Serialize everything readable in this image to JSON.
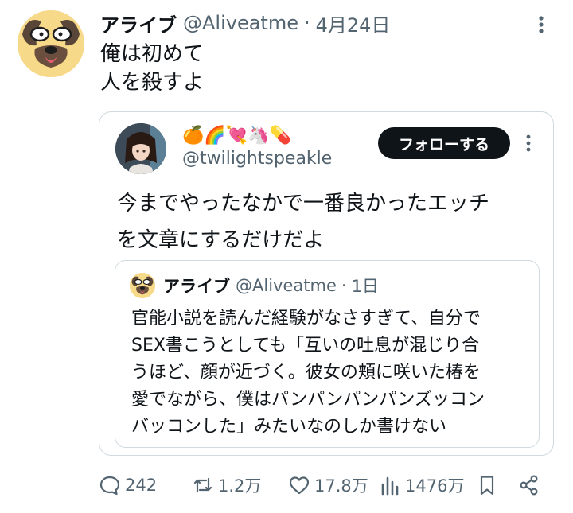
{
  "tweet": {
    "author_name": "アライブ",
    "author_handle": "@Aliveatme",
    "separator": "·",
    "date": "4月24日",
    "text": "俺は初めて\n人を殺すよ"
  },
  "quoted_tweet": {
    "emojis": "🍊🌈💘🦄💊",
    "handle": "@twilightspeakle",
    "follow_label": "フォローする",
    "text": "今までやったなかで一番良かったエッチ\nを文章にするだけだよ",
    "inner_quote": {
      "author_name": "アライブ",
      "author_handle": "@Aliveatme",
      "separator": "·",
      "date": "1日",
      "text": "官能小説を読んだ経験がなさすぎて、自分で\nSEX書こうとしても「互いの吐息が混じり合\nうほど、顔が近づく。彼女の頬に咲いた椿を\n愛でながら、僕はパンパンパンパンズッコン\nバッコンした」みたいなのしか書けない"
    }
  },
  "actions": {
    "replies": "242",
    "retweets": "1.2万",
    "likes": "17.8万",
    "views": "1476万"
  },
  "icons": [
    "dog-avatar-icon",
    "more-options-icon",
    "reply-icon",
    "retweet-icon",
    "like-icon",
    "views-icon",
    "bookmark-icon",
    "share-icon"
  ],
  "colors": {
    "text": "#0f1419",
    "secondary": "#536471",
    "border": "#cfd9de",
    "button": "#0f1419"
  }
}
